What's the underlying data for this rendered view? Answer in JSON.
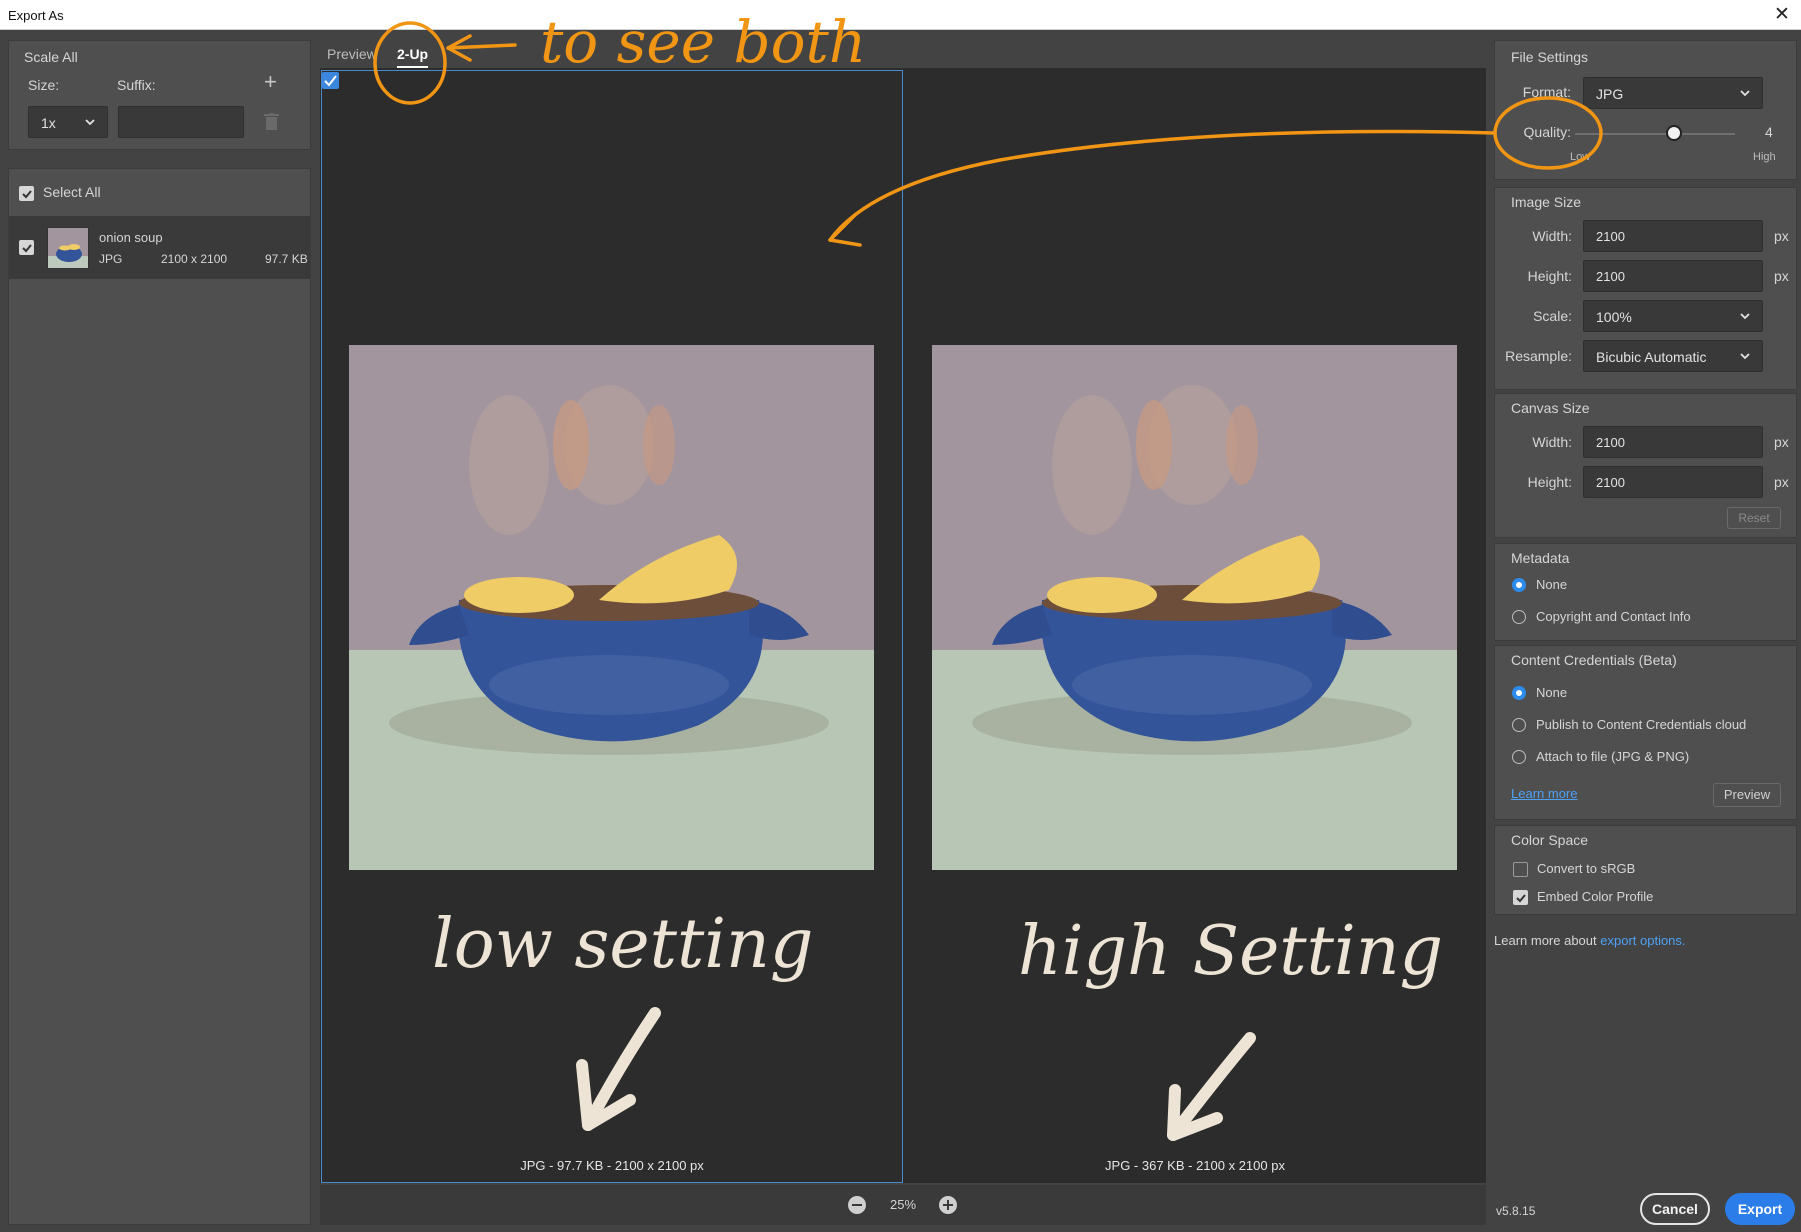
{
  "window": {
    "title": "Export As",
    "close_glyph": "✕"
  },
  "left_panel": {
    "scale_all_title": "Scale All",
    "size_label": "Size:",
    "suffix_label": "Suffix:",
    "size_value": "1x",
    "suffix_value": "",
    "select_all_label": "Select All",
    "asset": {
      "name": "onion soup",
      "format": "JPG",
      "dimensions": "2100 x 2100",
      "filesize": "97.7 KB"
    }
  },
  "tabs": {
    "preview": "Preview",
    "two_up": "2-Up"
  },
  "preview": {
    "left_caption": "JPG - 97.7 KB - 2100 x 2100 px",
    "right_caption": "JPG - 367 KB - 2100 x 2100 px",
    "left_handwriting": "low setting",
    "right_handwriting": "high Setting",
    "zoom": "25%"
  },
  "annotation": {
    "text": "to see both",
    "color": "#f09514"
  },
  "right_panel": {
    "file_settings": {
      "title": "File Settings",
      "format_label": "Format:",
      "format_value": "JPG",
      "quality_label": "Quality:",
      "quality_value": "4",
      "quality_min_label": "Low",
      "quality_max_label": "High"
    },
    "image_size": {
      "title": "Image Size",
      "width_label": "Width:",
      "width_value": "2100",
      "height_label": "Height:",
      "height_value": "2100",
      "unit": "px",
      "scale_label": "Scale:",
      "scale_value": "100%",
      "resample_label": "Resample:",
      "resample_value": "Bicubic Automatic"
    },
    "canvas_size": {
      "title": "Canvas Size",
      "width_label": "Width:",
      "width_value": "2100",
      "height_label": "Height:",
      "height_value": "2100",
      "unit": "px",
      "reset_label": "Reset"
    },
    "metadata": {
      "title": "Metadata",
      "option_none": "None",
      "option_copyright": "Copyright and Contact Info"
    },
    "content_credentials": {
      "title": "Content Credentials (Beta)",
      "option_none": "None",
      "option_publish": "Publish to Content Credentials cloud",
      "option_attach": "Attach to file (JPG & PNG)",
      "learn_more": "Learn more",
      "preview_button": "Preview"
    },
    "color_space": {
      "title": "Color Space",
      "convert_srgb": "Convert to sRGB",
      "embed_profile": "Embed Color Profile"
    },
    "learn_more_prefix": "Learn more about",
    "learn_more_link": "export options."
  },
  "footer": {
    "version": "v5.8.15",
    "cancel": "Cancel",
    "export": "Export"
  },
  "colors": {
    "accent": "#2b7de9",
    "annotation": "#f09514",
    "selection_border": "#4b89c9"
  }
}
